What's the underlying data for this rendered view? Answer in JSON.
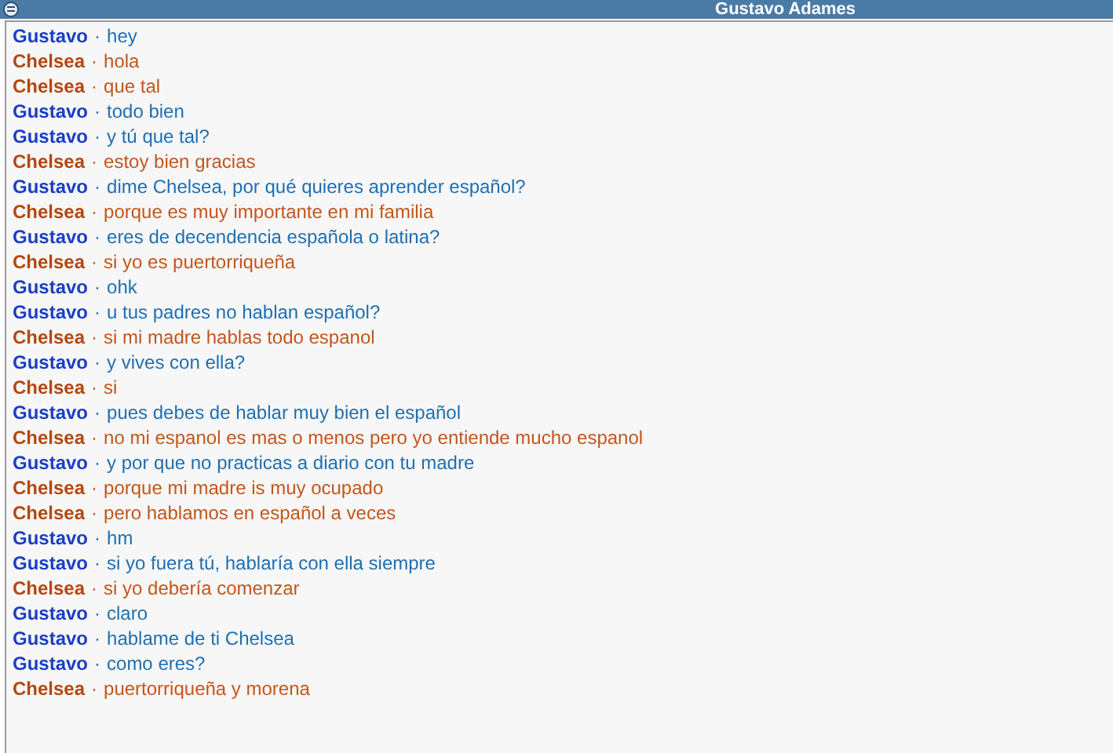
{
  "window": {
    "title": "Gustavo Adames"
  },
  "messages": [
    {
      "sender": "Gustavo",
      "separator": "·",
      "text": "hey",
      "kind": "gustavo",
      "color": "#1a3ec8"
    },
    {
      "sender": "Chelsea",
      "separator": "·",
      "text": "hola",
      "kind": "chelsea",
      "color": "#b5470e"
    },
    {
      "sender": "Chelsea",
      "separator": "·",
      "text": "que tal",
      "kind": "chelsea",
      "color": "#b5470e"
    },
    {
      "sender": "Gustavo",
      "separator": "·",
      "text": "todo bien",
      "kind": "gustavo",
      "color": "#1a3ec8"
    },
    {
      "sender": "Gustavo",
      "separator": "·",
      "text": "y tú que tal?",
      "kind": "gustavo",
      "color": "#1a3ec8"
    },
    {
      "sender": "Chelsea",
      "separator": "·",
      "text": "estoy bien gracias",
      "kind": "chelsea",
      "color": "#b5470e"
    },
    {
      "sender": "Gustavo",
      "separator": "·",
      "text": "dime Chelsea, por qué quieres aprender español?",
      "kind": "gustavo",
      "color": "#1a3ec8"
    },
    {
      "sender": "Chelsea",
      "separator": "·",
      "text": "porque es muy importante en mi familia",
      "kind": "chelsea",
      "color": "#b5470e"
    },
    {
      "sender": "Gustavo",
      "separator": "·",
      "text": "eres de decendencia española o latina?",
      "kind": "gustavo",
      "color": "#1a3ec8"
    },
    {
      "sender": "Chelsea",
      "separator": "·",
      "text": "si yo es puertorriqueña",
      "kind": "chelsea",
      "color": "#b5470e"
    },
    {
      "sender": "Gustavo",
      "separator": "·",
      "text": "ohk",
      "kind": "gustavo",
      "color": "#1a3ec8"
    },
    {
      "sender": "Gustavo",
      "separator": "·",
      "text": "u tus padres no hablan español?",
      "kind": "gustavo",
      "color": "#1a3ec8"
    },
    {
      "sender": "Chelsea",
      "separator": "·",
      "text": "si mi madre hablas todo espanol",
      "kind": "chelsea",
      "color": "#b5470e"
    },
    {
      "sender": "Gustavo",
      "separator": "·",
      "text": "y vives con ella?",
      "kind": "gustavo",
      "color": "#1a3ec8"
    },
    {
      "sender": "Chelsea",
      "separator": "·",
      "text": "si",
      "kind": "chelsea",
      "color": "#b5470e"
    },
    {
      "sender": "Gustavo",
      "separator": "·",
      "text": "pues debes de hablar muy bien el español",
      "kind": "gustavo",
      "color": "#1a3ec8"
    },
    {
      "sender": "Chelsea",
      "separator": "·",
      "text": "no mi espanol es mas o menos pero yo entiende mucho espanol",
      "kind": "chelsea",
      "color": "#b5470e"
    },
    {
      "sender": "Gustavo",
      "separator": "·",
      "text": "y por que no practicas a diario con tu madre",
      "kind": "gustavo",
      "color": "#1a3ec8"
    },
    {
      "sender": "Chelsea",
      "separator": "·",
      "text": "porque mi madre is muy ocupado",
      "kind": "chelsea",
      "color": "#b5470e"
    },
    {
      "sender": "Chelsea",
      "separator": "·",
      "text": "pero hablamos en español a veces",
      "kind": "chelsea",
      "color": "#b5470e"
    },
    {
      "sender": "Gustavo",
      "separator": "·",
      "text": "hm",
      "kind": "gustavo",
      "color": "#1a3ec8"
    },
    {
      "sender": "Gustavo",
      "separator": "·",
      "text": "si yo fuera tú, hablaría con ella siempre",
      "kind": "gustavo",
      "color": "#1a3ec8"
    },
    {
      "sender": "Chelsea",
      "separator": "·",
      "text": "si yo debería comenzar",
      "kind": "chelsea",
      "color": "#b5470e"
    },
    {
      "sender": "Gustavo",
      "separator": "·",
      "text": "claro",
      "kind": "gustavo",
      "color": "#1a3ec8"
    },
    {
      "sender": "Gustavo",
      "separator": "·",
      "text": "hablame de ti Chelsea",
      "kind": "gustavo",
      "color": "#1a3ec8"
    },
    {
      "sender": "Gustavo",
      "separator": "·",
      "text": "como eres?",
      "kind": "gustavo",
      "color": "#1a3ec8"
    },
    {
      "sender": "Chelsea",
      "separator": "·",
      "text": "puertorriqueña y morena",
      "kind": "chelsea",
      "color": "#b5470e"
    }
  ]
}
